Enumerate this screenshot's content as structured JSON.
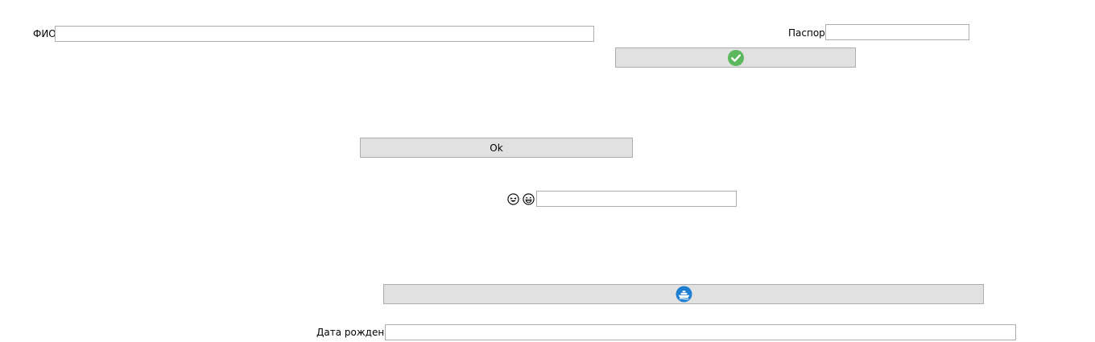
{
  "form": {
    "fio_label": "ФИО",
    "fio_value": "",
    "passport_label": "Паспорт",
    "passport_value": "",
    "ok_label": "Ok",
    "emoji_value": "",
    "birth_date_label": "Дата рождения",
    "birth_date_value": ""
  },
  "icons": {
    "confirm": "check-circle-icon",
    "emoji_1": "laughing-face-icon",
    "emoji_2": "grinning-face-icon",
    "wide_button": "ship-circle-icon"
  },
  "colors": {
    "button_bg": "#e1e1e1",
    "border": "#adadad",
    "check_green": "#5cb85c",
    "ship_blue": "#1e7fd2"
  }
}
